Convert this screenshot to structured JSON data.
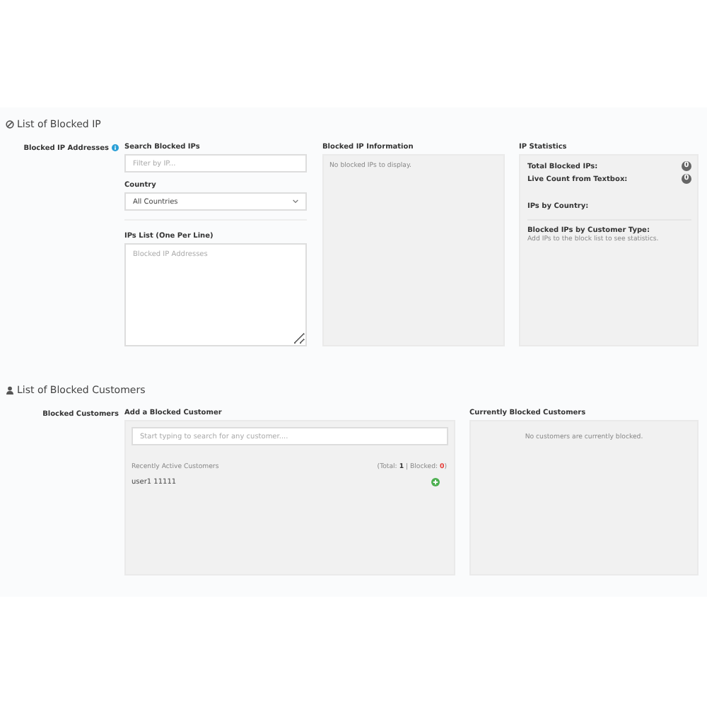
{
  "ip_section": {
    "title": "List of Blocked IP",
    "label": "Blocked IP Addresses",
    "search": {
      "label": "Search Blocked IPs",
      "placeholder": "Filter by IP..."
    },
    "country": {
      "label": "Country",
      "value": "All Countries"
    },
    "ips_list": {
      "label": "IPs List (One Per Line)",
      "placeholder": "Blocked IP Addresses"
    },
    "info": {
      "title": "Blocked IP Information",
      "message": "No blocked IPs to display."
    },
    "stats": {
      "title": "IP Statistics",
      "rows": [
        {
          "kind": "count",
          "label": "Total Blocked IPs:",
          "value": "0"
        },
        {
          "kind": "count",
          "label": "Live Count from Textbox:",
          "value": "0"
        },
        {
          "kind": "heading",
          "label": "IPs by Country:"
        },
        {
          "kind": "heading",
          "label": "Blocked IPs by Customer Type:",
          "note": "Add IPs to the block list to see statistics."
        }
      ]
    }
  },
  "customer_section": {
    "title": "List of Blocked Customers",
    "label": "Blocked Customers",
    "add": {
      "title": "Add a Blocked Customer",
      "placeholder": "Start typing to search for any customer....",
      "recent_label": "Recently Active Customers",
      "total_label": "(Total:",
      "total": "1",
      "blocked_label": "| Blocked:",
      "blocked": "0",
      "close": ")",
      "customers": [
        {
          "name": "user1 11111"
        }
      ]
    },
    "current": {
      "title": "Currently Blocked Customers",
      "message": "No customers are currently blocked."
    }
  }
}
